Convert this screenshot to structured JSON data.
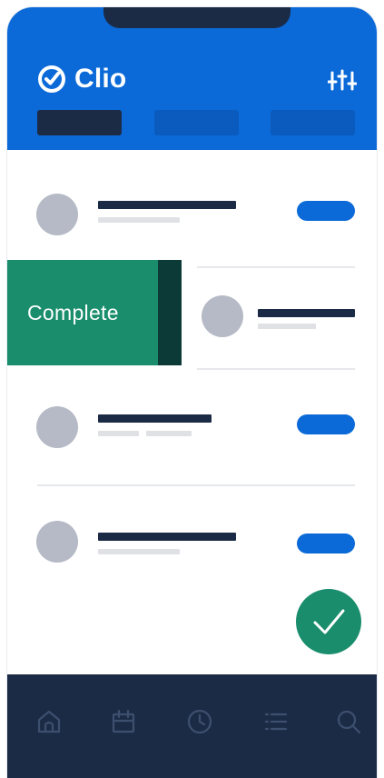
{
  "app": {
    "brand": "Clio",
    "logo_icon": "check-circle-icon",
    "filter_icon": "filter-sliders-icon"
  },
  "tabs": [
    {
      "state": "active"
    },
    {
      "state": "inactive"
    },
    {
      "state": "inactive"
    }
  ],
  "list": {
    "swipe_action_label": "Complete"
  },
  "fab": {
    "icon": "checkmark-icon"
  },
  "bottom_nav": [
    {
      "icon": "home-icon"
    },
    {
      "icon": "calendar-icon"
    },
    {
      "icon": "clock-icon"
    },
    {
      "icon": "list-icon"
    },
    {
      "icon": "search-icon"
    }
  ],
  "colors": {
    "brand_blue": "#0b6ad8",
    "navy": "#1c2b45",
    "complete_green": "#1a8d6c",
    "placeholder_gray": "#b5bac6"
  }
}
